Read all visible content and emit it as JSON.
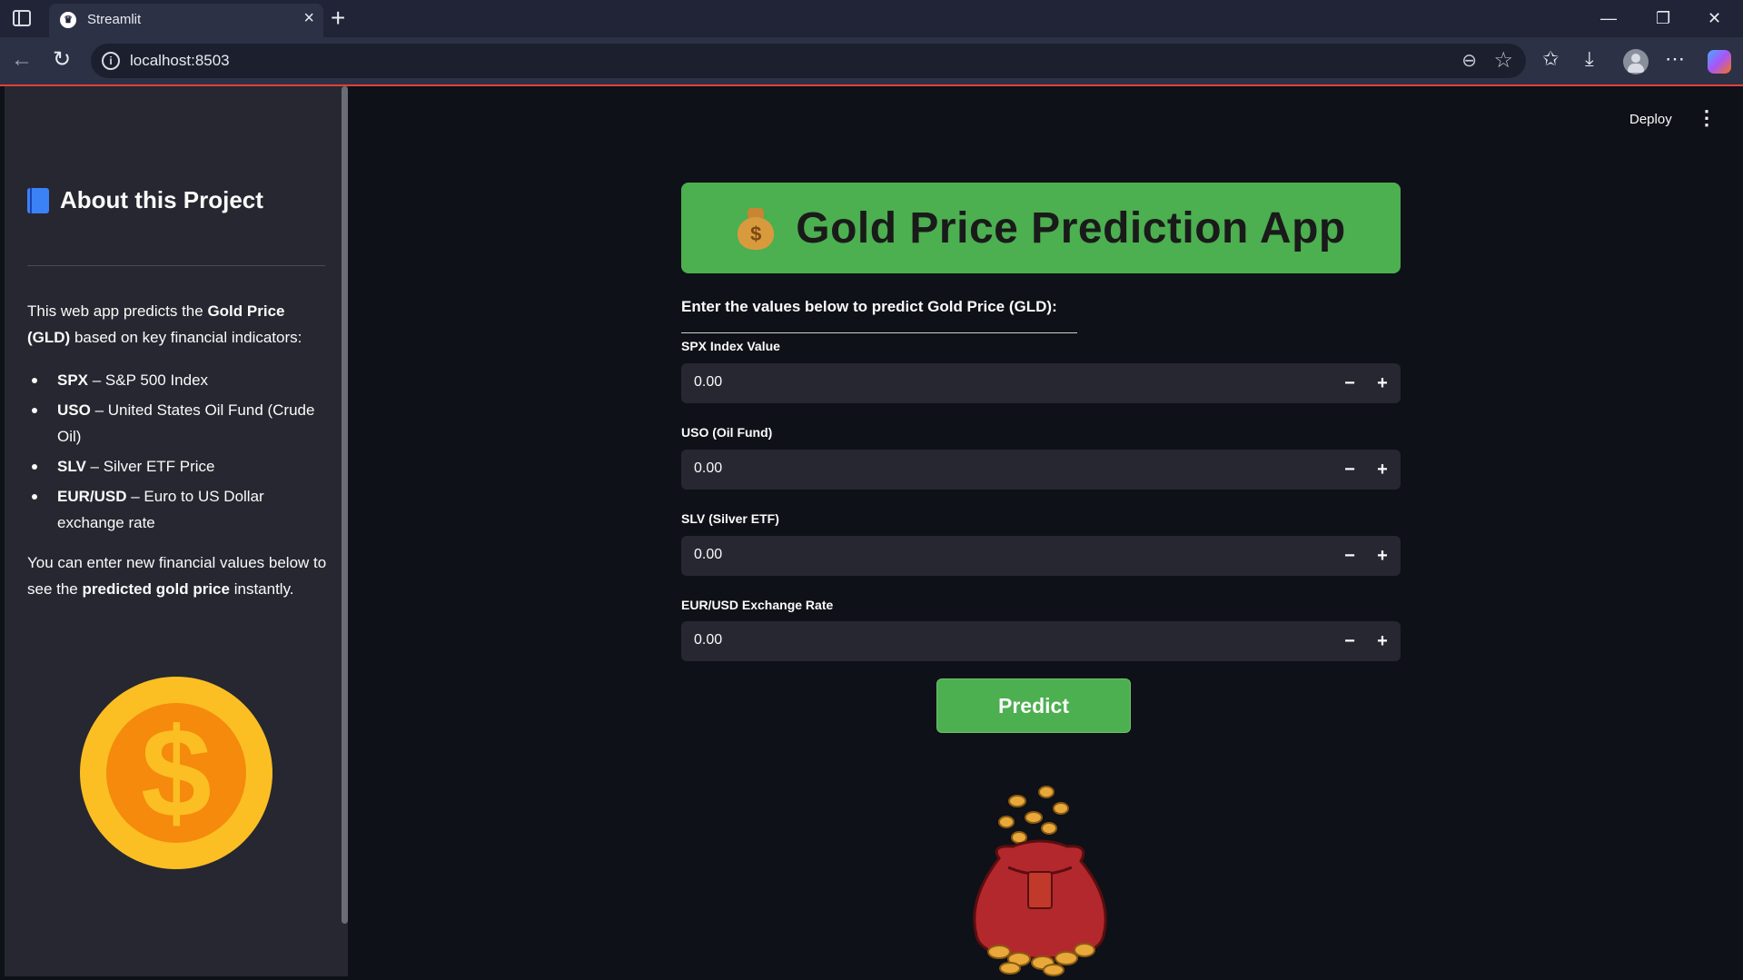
{
  "browser": {
    "tab_title": "Streamlit",
    "url": "localhost:8503",
    "new_tab_label": "+",
    "tab_close_label": "×"
  },
  "header": {
    "deploy_label": "Deploy",
    "menu_label": "⋮"
  },
  "sidebar": {
    "title": "About this Project",
    "intro_prefix": "This web app predicts the ",
    "intro_bold": "Gold Price (GLD)",
    "intro_suffix": " based on key financial indicators:",
    "items": [
      {
        "term": "SPX",
        "desc": " – S&P 500 Index"
      },
      {
        "term": "USO",
        "desc": " – United States Oil Fund (Crude Oil)"
      },
      {
        "term": "SLV",
        "desc": " – Silver ETF Price"
      },
      {
        "term": "EUR/USD",
        "desc": " – Euro to US Dollar exchange rate"
      }
    ],
    "outro_prefix": "You can enter new financial values below to see the ",
    "outro_bold": "predicted gold price",
    "outro_suffix": " instantly.",
    "coin_symbol": "$"
  },
  "main": {
    "banner_title": "Gold Price Prediction App",
    "banner_icon": "money-bag-icon",
    "subheading": "Enter the values below to predict Gold Price (GLD):",
    "fields": [
      {
        "label": "SPX Index Value",
        "value": "0.00"
      },
      {
        "label": "USO (Oil Fund)",
        "value": "0.00"
      },
      {
        "label": "SLV (Silver ETF)",
        "value": "0.00"
      },
      {
        "label": "EUR/USD Exchange Rate",
        "value": "0.00"
      }
    ],
    "stepper_minus": "−",
    "stepper_plus": "+",
    "predict_label": "Predict"
  },
  "colors": {
    "accent_green": "#4caf50",
    "sidebar_bg": "#262730",
    "app_bg": "#0e1117",
    "coin_outer": "#fbbf24",
    "coin_inner": "#f58a0c"
  }
}
